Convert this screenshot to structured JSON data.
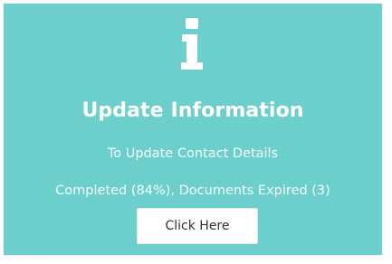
{
  "card": {
    "background_color": "#6ccfcb",
    "icon": "info-icon",
    "title": "Update Information",
    "subtitle": "To Update Contact Details",
    "status": "Completed (84%), Documents Expired (3)",
    "button_label": "Click Here"
  }
}
